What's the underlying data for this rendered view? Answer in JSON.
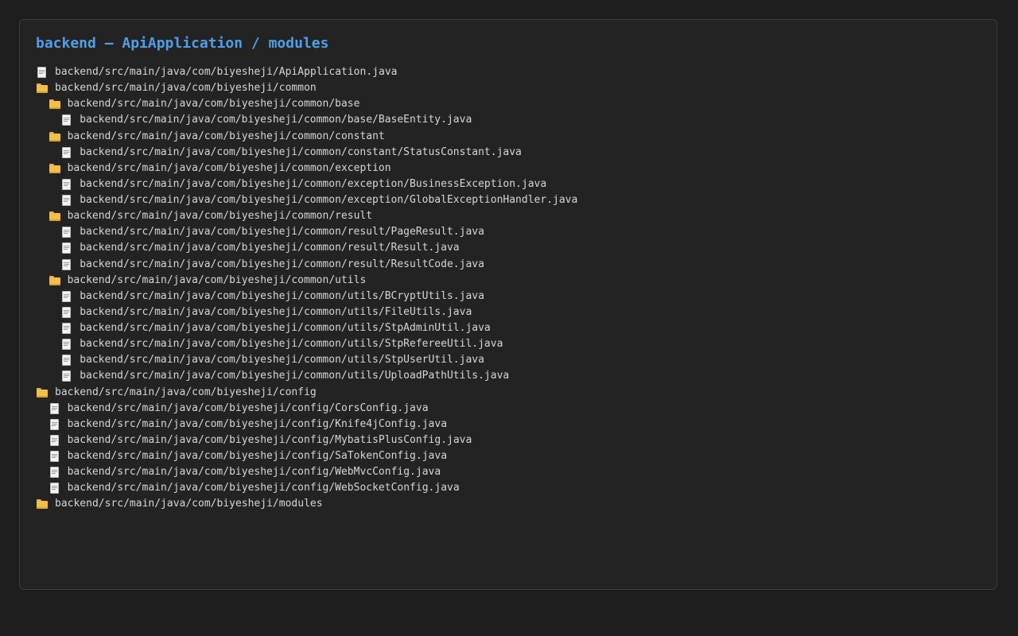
{
  "title": "backend — ApiApplication / modules",
  "tree": [
    {
      "type": "file",
      "depth": 0,
      "path": "backend/src/main/java/com/biyesheji/ApiApplication.java"
    },
    {
      "type": "folder",
      "depth": 0,
      "path": "backend/src/main/java/com/biyesheji/common"
    },
    {
      "type": "folder",
      "depth": 1,
      "path": "backend/src/main/java/com/biyesheji/common/base"
    },
    {
      "type": "file",
      "depth": 2,
      "path": "backend/src/main/java/com/biyesheji/common/base/BaseEntity.java"
    },
    {
      "type": "folder",
      "depth": 1,
      "path": "backend/src/main/java/com/biyesheji/common/constant"
    },
    {
      "type": "file",
      "depth": 2,
      "path": "backend/src/main/java/com/biyesheji/common/constant/StatusConstant.java"
    },
    {
      "type": "folder",
      "depth": 1,
      "path": "backend/src/main/java/com/biyesheji/common/exception"
    },
    {
      "type": "file",
      "depth": 2,
      "path": "backend/src/main/java/com/biyesheji/common/exception/BusinessException.java"
    },
    {
      "type": "file",
      "depth": 2,
      "path": "backend/src/main/java/com/biyesheji/common/exception/GlobalExceptionHandler.java"
    },
    {
      "type": "folder",
      "depth": 1,
      "path": "backend/src/main/java/com/biyesheji/common/result"
    },
    {
      "type": "file",
      "depth": 2,
      "path": "backend/src/main/java/com/biyesheji/common/result/PageResult.java"
    },
    {
      "type": "file",
      "depth": 2,
      "path": "backend/src/main/java/com/biyesheji/common/result/Result.java"
    },
    {
      "type": "file",
      "depth": 2,
      "path": "backend/src/main/java/com/biyesheji/common/result/ResultCode.java"
    },
    {
      "type": "folder",
      "depth": 1,
      "path": "backend/src/main/java/com/biyesheji/common/utils"
    },
    {
      "type": "file",
      "depth": 2,
      "path": "backend/src/main/java/com/biyesheji/common/utils/BCryptUtils.java"
    },
    {
      "type": "file",
      "depth": 2,
      "path": "backend/src/main/java/com/biyesheji/common/utils/FileUtils.java"
    },
    {
      "type": "file",
      "depth": 2,
      "path": "backend/src/main/java/com/biyesheji/common/utils/StpAdminUtil.java"
    },
    {
      "type": "file",
      "depth": 2,
      "path": "backend/src/main/java/com/biyesheji/common/utils/StpRefereeUtil.java"
    },
    {
      "type": "file",
      "depth": 2,
      "path": "backend/src/main/java/com/biyesheji/common/utils/StpUserUtil.java"
    },
    {
      "type": "file",
      "depth": 2,
      "path": "backend/src/main/java/com/biyesheji/common/utils/UploadPathUtils.java"
    },
    {
      "type": "folder",
      "depth": 0,
      "path": "backend/src/main/java/com/biyesheji/config"
    },
    {
      "type": "file",
      "depth": 1,
      "path": "backend/src/main/java/com/biyesheji/config/CorsConfig.java"
    },
    {
      "type": "file",
      "depth": 1,
      "path": "backend/src/main/java/com/biyesheji/config/Knife4jConfig.java"
    },
    {
      "type": "file",
      "depth": 1,
      "path": "backend/src/main/java/com/biyesheji/config/MybatisPlusConfig.java"
    },
    {
      "type": "file",
      "depth": 1,
      "path": "backend/src/main/java/com/biyesheji/config/SaTokenConfig.java"
    },
    {
      "type": "file",
      "depth": 1,
      "path": "backend/src/main/java/com/biyesheji/config/WebMvcConfig.java"
    },
    {
      "type": "file",
      "depth": 1,
      "path": "backend/src/main/java/com/biyesheji/config/WebSocketConfig.java"
    },
    {
      "type": "folder",
      "depth": 0,
      "path": "backend/src/main/java/com/biyesheji/modules"
    }
  ]
}
